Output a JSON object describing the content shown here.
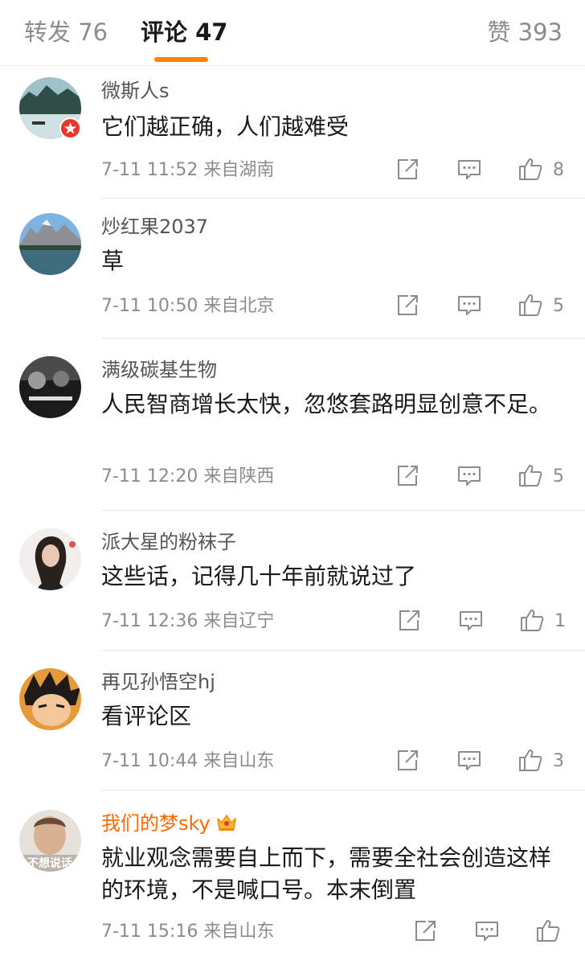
{
  "tabs": {
    "forward_label": "转发 76",
    "comments_label": "评论 47",
    "likes_label": "赞 393"
  },
  "comments": [
    {
      "user": "微斯人s",
      "text": "它们越正确，人们越难受",
      "time": "7-11 11:52",
      "location": "来自湖南",
      "likes": "8"
    },
    {
      "user": "炒红果2037",
      "text": "草",
      "time": "7-11 10:50",
      "location": "来自北京",
      "likes": "5"
    },
    {
      "user": "满级碳基生物",
      "text": "人民智商增长太快，忽悠套路明显创意不足。",
      "time": "7-11 12:20",
      "location": "来自陕西",
      "likes": "5"
    },
    {
      "user": "派大星的粉袜子",
      "text": "这些话，记得几十年前就说过了",
      "time": "7-11 12:36",
      "location": "来自辽宁",
      "likes": "1"
    },
    {
      "user": "再见孙悟空hj",
      "text": "看评论区",
      "time": "7-11 10:44",
      "location": "来自山东",
      "likes": "3"
    },
    {
      "user": "我们的梦sky",
      "text": "就业观念需要自上而下，需要全社会创造这样的环境，不是喊口号。本末倒置",
      "time": "7-11 15:16",
      "location": "来自山东",
      "likes": ""
    }
  ],
  "avatar_overlay_text": "不想说话",
  "icons": {
    "share": "share-icon",
    "reply": "comment-icon",
    "like": "thumbs-up-icon",
    "vip": "crown-icon"
  },
  "colors": {
    "accent": "#ff8200",
    "vip_name": "#ff6a00",
    "secondary_text": "#8c8c8c",
    "badge": "#e8362b"
  }
}
